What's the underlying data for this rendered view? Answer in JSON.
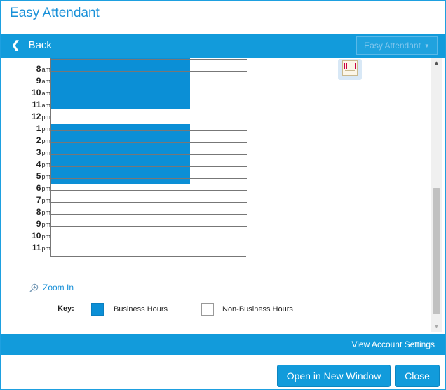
{
  "app": {
    "title": "Easy Attendant"
  },
  "nav": {
    "back_label": "Back",
    "menu_label": "Easy Attendant"
  },
  "schedule": {
    "hours": [
      {
        "num": "8",
        "ampm": "am"
      },
      {
        "num": "9",
        "ampm": "am"
      },
      {
        "num": "10",
        "ampm": "am"
      },
      {
        "num": "11",
        "ampm": "am"
      },
      {
        "num": "12",
        "ampm": "pm"
      },
      {
        "num": "1",
        "ampm": "pm"
      },
      {
        "num": "2",
        "ampm": "pm"
      },
      {
        "num": "3",
        "ampm": "pm"
      },
      {
        "num": "4",
        "ampm": "pm"
      },
      {
        "num": "5",
        "ampm": "pm"
      },
      {
        "num": "6",
        "ampm": "pm"
      },
      {
        "num": "7",
        "ampm": "pm"
      },
      {
        "num": "8",
        "ampm": "pm"
      },
      {
        "num": "9",
        "ampm": "pm"
      },
      {
        "num": "10",
        "ampm": "pm"
      },
      {
        "num": "11",
        "ampm": "pm"
      }
    ],
    "business_days": 5,
    "total_days": 7
  },
  "zoom": {
    "label": "Zoom In"
  },
  "key": {
    "label": "Key:",
    "business": "Business Hours",
    "non_business": "Non-Business Hours",
    "business_color": "#0b8fd6"
  },
  "footer": {
    "account_link": "View Account Settings"
  },
  "actions": {
    "open_label": "Open in New Window",
    "close_label": "Close"
  },
  "colors": {
    "accent": "#129bdb",
    "title": "#1890d8"
  }
}
